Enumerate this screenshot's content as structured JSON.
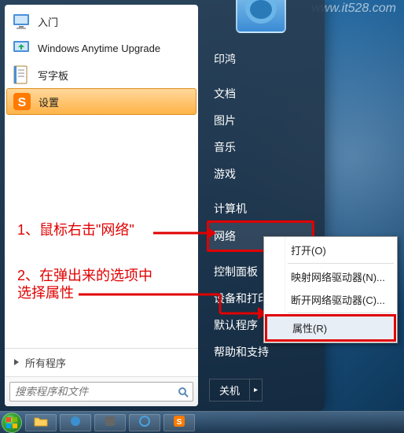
{
  "watermark": "www.it528.com",
  "start_menu": {
    "programs": [
      {
        "label": "入门",
        "icon": "monitor"
      },
      {
        "label": "Windows Anytime Upgrade",
        "icon": "upgrade"
      },
      {
        "label": "写字板",
        "icon": "notepad"
      },
      {
        "label": "设置",
        "icon": "settings-s",
        "highlighted": true
      }
    ],
    "all_programs": "所有程序",
    "search_placeholder": "搜索程序和文件",
    "right_items": [
      "印鸿",
      "文档",
      "图片",
      "音乐",
      "游戏",
      "计算机",
      "网络",
      "控制面板",
      "设备和打印机",
      "默认程序",
      "帮助和支持"
    ],
    "network_index": 6,
    "shutdown_label": "关机"
  },
  "context_menu": {
    "items": [
      "打开(O)",
      "映射网络驱动器(N)...",
      "断开网络驱动器(C)...",
      "属性(R)"
    ],
    "selected_index": 3
  },
  "annotations": {
    "step1": "1、鼠标右击\"网络\"",
    "step2_line1": "2、在弹出来的选项中",
    "step2_line2": "选择属性"
  }
}
